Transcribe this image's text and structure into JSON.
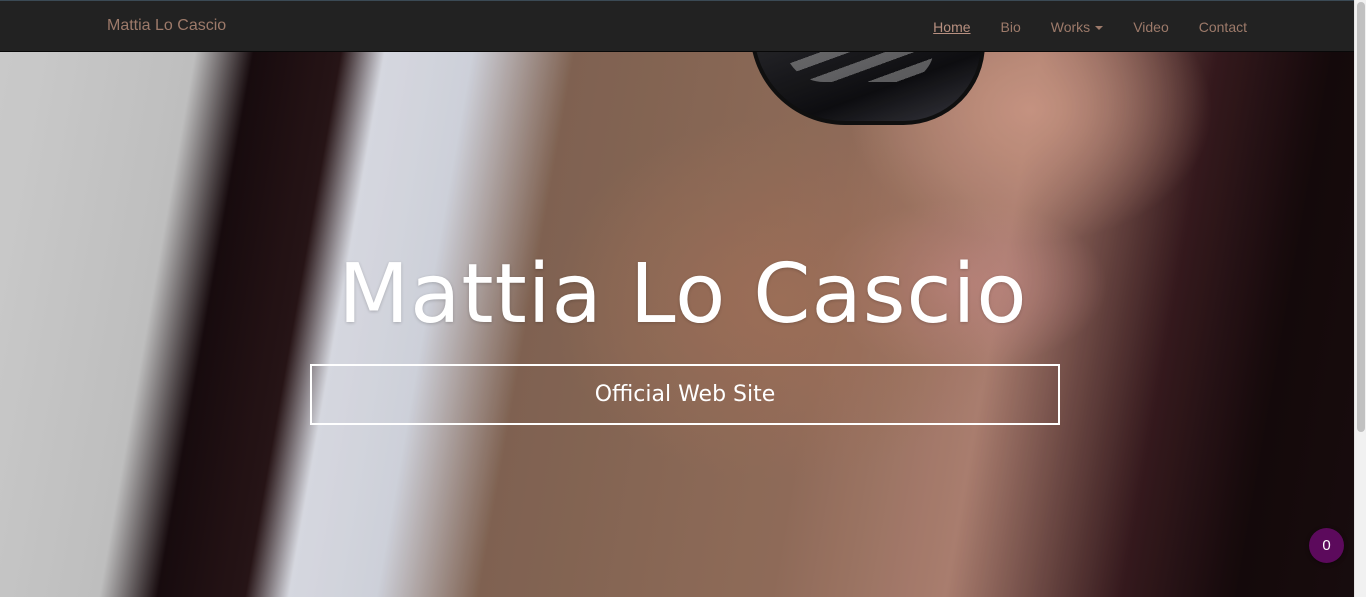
{
  "navbar": {
    "brand": "Mattia Lo Cascio",
    "items": [
      {
        "label": "Home",
        "active": true
      },
      {
        "label": "Bio"
      },
      {
        "label": "Works",
        "dropdown": true
      },
      {
        "label": "Video"
      },
      {
        "label": "Contact"
      }
    ]
  },
  "hero": {
    "title": "Mattia Lo Cascio",
    "subtitle": "Official Web Site"
  },
  "badge": {
    "count": "0",
    "color": "#5c0a5c"
  },
  "colors": {
    "navbar_bg": "#222222",
    "nav_link": "#9d7a6a"
  }
}
